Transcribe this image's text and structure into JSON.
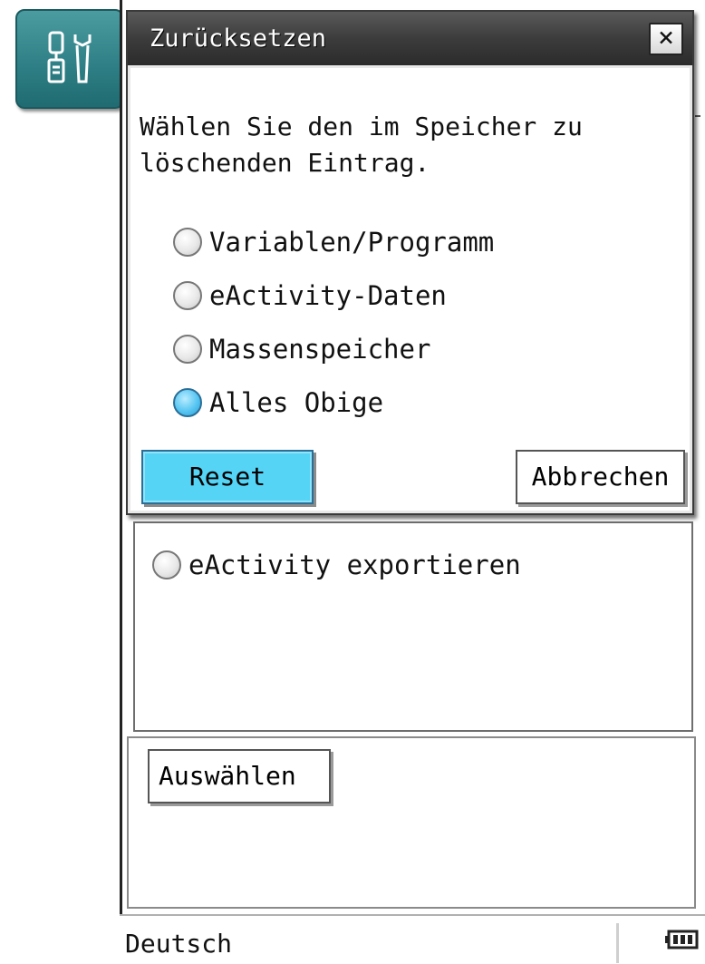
{
  "app": {
    "icon": "tools-icon",
    "accent": "#2f8187"
  },
  "background": {
    "export_option": "eActivity exportieren",
    "choose_button": "Auswählen"
  },
  "status_bar": {
    "language": "Deutsch",
    "battery_icon": "battery-icon"
  },
  "dialog": {
    "title": "Zurücksetzen",
    "close_icon": "close-icon",
    "prompt": "Wählen Sie den im Speicher zu löschenden Eintrag.",
    "options": [
      {
        "label": "Variablen/Programm",
        "selected": false
      },
      {
        "label": "eActivity-Daten",
        "selected": false
      },
      {
        "label": "Massenspeicher",
        "selected": false
      },
      {
        "label": "Alles Obige",
        "selected": true
      }
    ],
    "reset_button": "Reset",
    "cancel_button": "Abbrechen",
    "selected_color": "#55d4f6"
  }
}
